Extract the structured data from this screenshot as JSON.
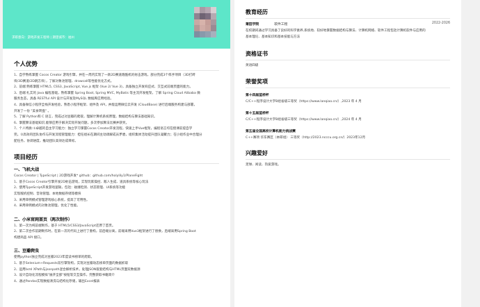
{
  "header": {
    "info": "求职意向：游戏开发工程师 | 期望城市：福州"
  },
  "advantages": {
    "title": "个人优势",
    "lines": [
      "1、自学熟练掌握 Cocos Creator 游戏引擎，并在一周内实现了一款2D赛道跑酷机的射击游戏，部分完成3个练手项目（3D打砖",
      "块/3D赛道/2D跳方块），了解对象池管理、drawcall等性能优化方式。",
      "2、前端:熟练掌握 HTML5, CSS3, JavaScript, Vue.js 框架 (Vue 2/ Vue 3)，具备独立开发响应式、交互式前端页面的能力。",
      "3、后端:扎实的 Java 编程基础，熟练掌握 Spring Boot, Spring MVC, MyBatis 等主流开发框架，了解 Spring Cloud Alibaba 微",
      "服务生态，具备 RESTful API 设计与开发及MySQL 数据库应用经验。",
      "4、具备微信小程序全栈开发经验，熟悉小程序框架、组件及 API，并能运用微信云开发 (CloudBase) 进行后端服务构建与部署，",
      "开发了一份 \"美食转盘\" 。",
      "5、了解 Python和 C 语言，完成过对豆瓣的爬取，理解计算机系统原理，数据结构与算法基础知识。",
      "6、掌握算法基础知识,能够应用于解决实际开发问题，多次参加算法比赛并获奖。",
      "7、个人特质:①卓越的自主学习能力：独立学习掌握Cocos Creator开发流程，快速上手Vue框架，编程语言均在授课前提自学",
      "完。②高效的团队协作与开发流程管理能力：担任组长在期间主动调解成员矛盾，组织集体活动提升团队凝聚力；在小组作业中合理分",
      "配任务，协调进度，推动团队高效达成目标。"
    ]
  },
  "projects": {
    "title": "项目经历",
    "items": [
      {
        "name": "一、飞机大战",
        "lines": [
          "Cocos Creator | TypeScript | 2D游戏开发*  github：github.com/holylily1/PlaneFight",
          "1、基于Cocos Creator引擎开发2D射击游戏，实现玩家操控、敌人生成、道具系统等核心玩法",
          "2、使用TypeScript开发游戏逻辑，包括：碰撞检测、状态管理、UI系统等功能",
          "实现敌机控制、音效管理、本地数据存储等模块",
          "3、采用单例模式管理游戏核心系统，提高了可用性。",
          "4、采用单例模式的对象池管理，优化了性能。"
        ]
      },
      {
        "name": "二、小米官网首页（两次制作）",
        "lines": [
          "1、第一次为纯前端制作，基于 HTML5/CSS3/JavaScript还原了首页。",
          "2、第二次合作前期制作时，在第一次的代码上进行了重构，前后端分离，前端采用Vue3框架进行了替换，后端采用Spring Boot",
          "构建商品 API 接口。"
        ]
      },
      {
        "name": "三、豆瓣爬虫",
        "lines": [
          "使用python独立完成对豆瓣2023年度读书榜单的爬取。",
          "1、基于Selenium+Requests双引擎架构，实现对豆瓣动态榜单页面的数据抓取",
          "2、运用lxml XPath与jsonpath混合解析技术，处理JSON嵌套结构与HTML页面双数据源",
          "3、设计自动化流程模拟\"展开全部\"按钮等交互操作，完整获取书籍简介",
          "4、通过Pandas实现数据清洗与结构化存储，输出Excel报表"
        ]
      }
    ]
  },
  "education": {
    "title": "教育经历",
    "school": "莆田学院",
    "major": "软件工程",
    "period": "2022-2026",
    "lines": [
      "在校期间通过学习具备了良好的科学素养,系统地、较好地掌握数据结构与算法、计算机网络、软件工程包括计算机软件与应用的",
      "基本理论、基本知识和基本技能与方法"
    ]
  },
  "certificates": {
    "title": "资格证书",
    "text": "英语四级"
  },
  "awards": {
    "title": "荣誉奖项",
    "items": [
      {
        "name": "第十四届蓝桥杯",
        "detail": "C/C++程序设计大学B组省级三等奖（https://www.lanqiao.cn/）,2023 年 4 月"
      },
      {
        "name": "第十五届蓝桥杯",
        "detail": "C/C++程序设计大学B组省级三等奖（https://www.lanqiao.cn/）,2024 年 4 月"
      },
      {
        "name": "第五届全国高校计算机能力挑战赛",
        "detail": "C++赛项 华东赛区（本研组） 三等奖（http://2023.ncccu.org.cn/）2023年12月"
      }
    ]
  },
  "hobbies": {
    "title": "兴趣爱好",
    "text": "足球、阅读、热爱游戏。"
  },
  "colors": {
    "accent": "#5de6c9",
    "background": "#f1f1f1"
  }
}
